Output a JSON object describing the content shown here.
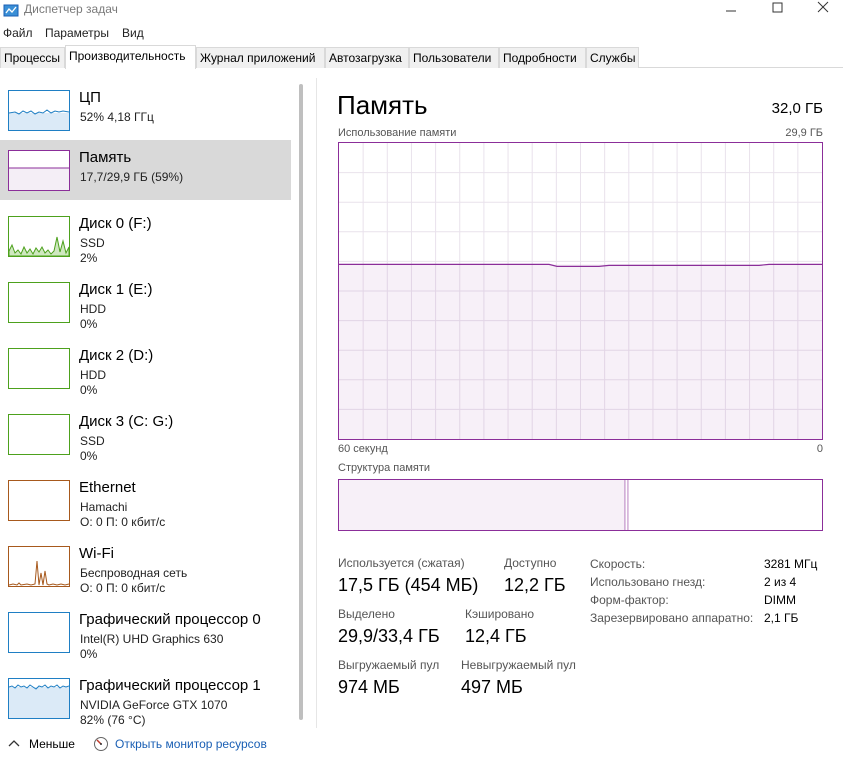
{
  "window": {
    "title": "Диспетчер задач"
  },
  "menu": [
    "Файл",
    "Параметры",
    "Вид"
  ],
  "tabs": [
    "Процессы",
    "Производительность",
    "Журнал приложений",
    "Автозагрузка",
    "Пользователи",
    "Подробности",
    "Службы"
  ],
  "active_tab": 1,
  "sidebar": {
    "items": [
      {
        "name": "ЦП",
        "line1": "52% 4,18 ГГц",
        "line2": "",
        "color": "#1f7fc4"
      },
      {
        "name": "Память",
        "line1": "17,7/29,9 ГБ (59%)",
        "line2": "",
        "color": "#8b2e99"
      },
      {
        "name": "Диск 0 (F:)",
        "line1": "SSD",
        "line2": "2%",
        "color": "#4da11d"
      },
      {
        "name": "Диск 1 (E:)",
        "line1": "HDD",
        "line2": "0%",
        "color": "#4da11d"
      },
      {
        "name": "Диск 2 (D:)",
        "line1": "HDD",
        "line2": "0%",
        "color": "#4da11d"
      },
      {
        "name": "Диск 3 (C: G:)",
        "line1": "SSD",
        "line2": "0%",
        "color": "#4da11d"
      },
      {
        "name": "Ethernet",
        "line1": "Hamachi",
        "line2": "О: 0 П: 0 кбит/с",
        "color": "#a7591d"
      },
      {
        "name": "Wi-Fi",
        "line1": "Беспроводная сеть",
        "line2": "О: 0 П: 0 кбит/с",
        "color": "#a7591d"
      },
      {
        "name": "Графический процессор 0",
        "line1": "Intel(R) UHD Graphics 630",
        "line2": "0%",
        "color": "#1f7fc4"
      },
      {
        "name": "Графический процессор 1",
        "line1": "NVIDIA GeForce GTX 1070",
        "line2": "82% (76 °C)",
        "color": "#1f7fc4"
      }
    ]
  },
  "main": {
    "title": "Память",
    "total": "32,0 ГБ",
    "usage_label": "Использование памяти",
    "usage_max": "29,9 ГБ",
    "time_left": "60 секунд",
    "time_right": "0",
    "structure_label": "Структура памяти",
    "usage_fraction": 0.59,
    "structure_used_fraction": 0.592,
    "stats": {
      "in_use_label": "Используется (сжатая)",
      "in_use_value": "17,5 ГБ (454 МБ)",
      "available_label": "Доступно",
      "available_value": "12,2 ГБ",
      "committed_label": "Выделено",
      "committed_value": "29,9/33,4 ГБ",
      "cached_label": "Кэшировано",
      "cached_value": "12,4 ГБ",
      "paged_label": "Выгружаемый пул",
      "paged_value": "974 МБ",
      "nonpaged_label": "Невыгружаемый пул",
      "nonpaged_value": "497 МБ"
    },
    "props": [
      {
        "label": "Скорость:",
        "value": "3281 МГц"
      },
      {
        "label": "Использовано гнезд:",
        "value": "2 из 4"
      },
      {
        "label": "Форм-фактор:",
        "value": "DIMM"
      },
      {
        "label": "Зарезервировано аппаратно:",
        "value": "2,1 ГБ"
      }
    ]
  },
  "footer": {
    "fewer": "Меньше",
    "monitor": "Открыть монитор ресурсов"
  },
  "icons": {
    "app": "task-manager-icon",
    "minimize": "minimize-icon",
    "maximize": "maximize-icon",
    "close": "close-icon",
    "fewer": "chevron-up-icon",
    "monitor": "resource-monitor-icon"
  },
  "colors": {
    "memory": "#8b2e99",
    "cpu": "#1f7fc4",
    "disk": "#4da11d",
    "network": "#a7591d"
  }
}
